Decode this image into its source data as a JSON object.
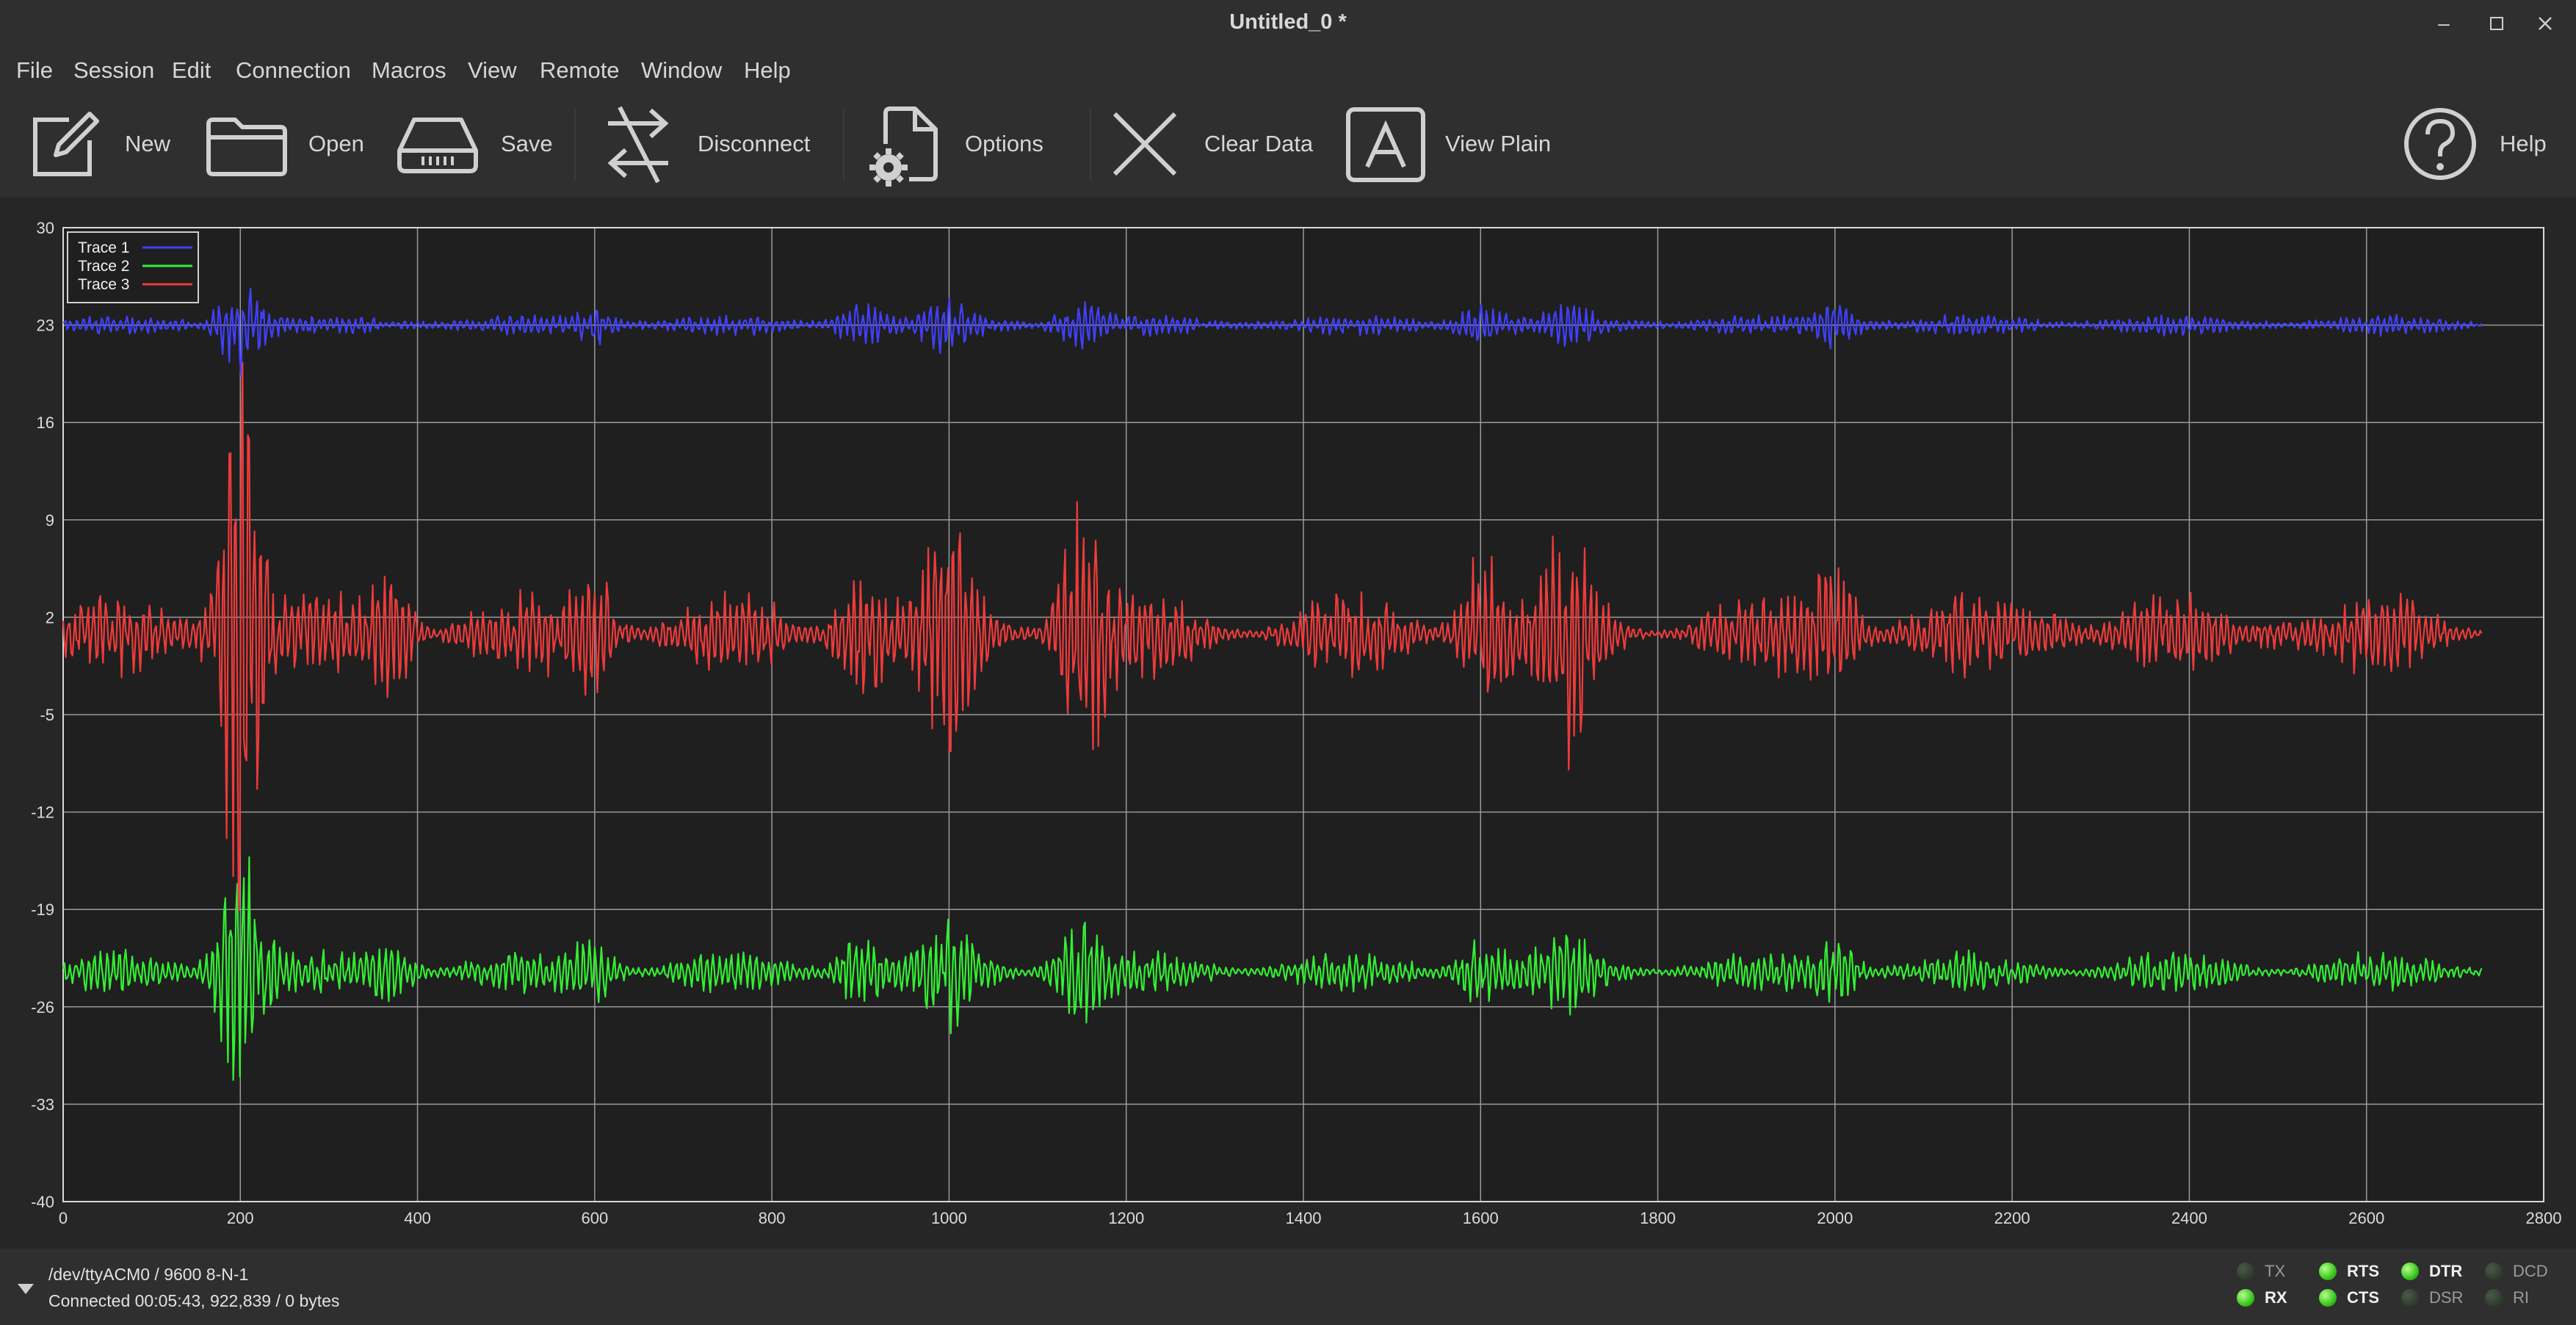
{
  "window": {
    "title": "Untitled_0 *"
  },
  "menu": [
    "File",
    "Session",
    "Edit",
    "Connection",
    "Macros",
    "View",
    "Remote",
    "Window",
    "Help"
  ],
  "toolbar": {
    "new": "New",
    "open": "Open",
    "save": "Save",
    "disconnect": "Disconnect",
    "options": "Options",
    "clear": "Clear Data",
    "view_plain": "View Plain",
    "help": "Help"
  },
  "status": {
    "port": "/dev/ttyACM0 / 9600 8-N-1",
    "connection": "Connected 00:05:43, 922,839 / 0 bytes"
  },
  "signals": [
    {
      "name": "TX",
      "on": false
    },
    {
      "name": "RTS",
      "on": true
    },
    {
      "name": "DTR",
      "on": true
    },
    {
      "name": "DCD",
      "on": false
    },
    {
      "name": "RX",
      "on": true
    },
    {
      "name": "CTS",
      "on": true
    },
    {
      "name": "DSR",
      "on": false
    },
    {
      "name": "RI",
      "on": false
    }
  ],
  "colors": {
    "trace1": "#4040ff",
    "trace2": "#33ee33",
    "trace3": "#ee3b3b",
    "grid": "#9a9a9a",
    "plot_bg": "#1f1f1f"
  },
  "chart_data": {
    "type": "line",
    "xlim": [
      0,
      2800
    ],
    "ylim": [
      -40,
      30
    ],
    "x_ticks": [
      0,
      200,
      400,
      600,
      800,
      1000,
      1200,
      1400,
      1600,
      1800,
      2000,
      2200,
      2400,
      2600,
      2800
    ],
    "y_ticks": [
      30,
      23,
      16,
      9,
      2,
      -5,
      -12,
      -19,
      -26,
      -33,
      -40
    ],
    "grid": true,
    "legend_position": "top-left",
    "series": [
      {
        "name": "Trace 1",
        "color": "#4040ff",
        "baseline": 23,
        "bursts": [
          [
            200,
            3.0
          ],
          [
            600,
            1.0
          ],
          [
            900,
            1.2
          ],
          [
            1000,
            1.4
          ],
          [
            1150,
            1.3
          ],
          [
            1600,
            1.0
          ],
          [
            1700,
            1.0
          ],
          [
            2000,
            1.2
          ]
        ]
      },
      {
        "name": "Trace 2",
        "color": "#33ee33",
        "baseline": -23.5,
        "bursts": [
          [
            200,
            8.0
          ],
          [
            370,
            1.5
          ],
          [
            600,
            1.8
          ],
          [
            900,
            2.5
          ],
          [
            1000,
            2.8
          ],
          [
            1150,
            4.0
          ],
          [
            1600,
            2.0
          ],
          [
            1700,
            2.0
          ],
          [
            2000,
            1.8
          ]
        ]
      },
      {
        "name": "Trace 3",
        "color": "#ee3b3b",
        "baseline": 0.8,
        "bursts": [
          [
            200,
            18.0
          ],
          [
            370,
            4.0
          ],
          [
            600,
            3.5
          ],
          [
            900,
            5.0
          ],
          [
            1000,
            6.0
          ],
          [
            1150,
            8.5
          ],
          [
            1600,
            5.0
          ],
          [
            1700,
            6.0
          ],
          [
            2000,
            4.5
          ],
          [
            2250,
            1.2
          ],
          [
            2500,
            1.0
          ]
        ]
      }
    ]
  }
}
